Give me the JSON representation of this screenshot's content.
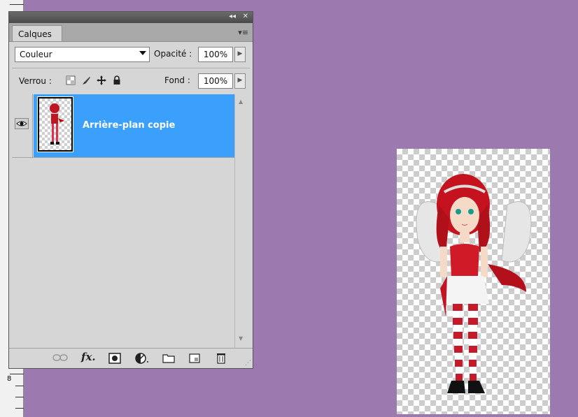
{
  "panel": {
    "title_controls": {
      "collapse": "◂◂",
      "close": "✕"
    },
    "tab_label": "Calques",
    "blend_mode": "Couleur",
    "opacity_label": "Opacité :",
    "opacity_value": "100%",
    "lock_label": "Verrou :",
    "fill_label": "Fond :",
    "fill_value": "100%",
    "layers": [
      {
        "name": "Arrière-plan copie",
        "visible": true,
        "selected": true
      }
    ],
    "footer_icons": [
      "link-layers-icon",
      "fx-icon",
      "mask-icon",
      "adjustment-icon",
      "group-folder-icon",
      "new-layer-icon",
      "trash-icon"
    ]
  },
  "ruler": {
    "label": "8"
  },
  "colors": {
    "workspace": "#9c7ab0",
    "selection": "#3aa0fb"
  }
}
